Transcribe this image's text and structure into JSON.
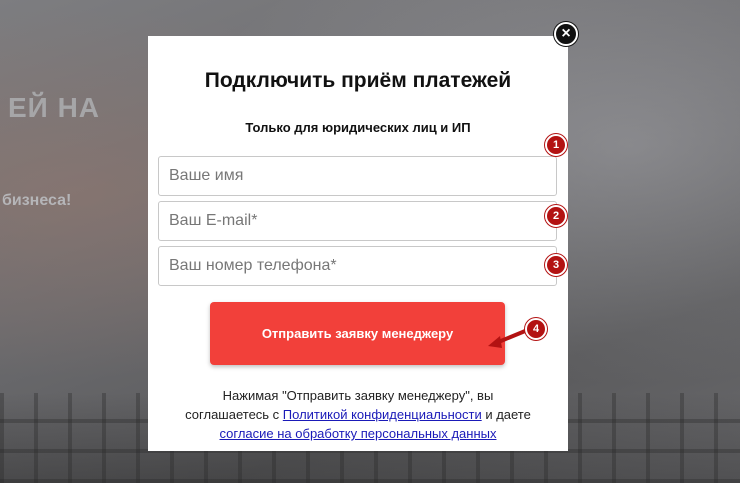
{
  "background": {
    "heading": "ЕЙ НА",
    "subtext": "бизнеса!"
  },
  "modal": {
    "close_symbol": "×",
    "title": "Подключить приём платежей",
    "subtitle": "Только для юридических лиц и ИП",
    "fields": {
      "name_placeholder": "Ваше имя",
      "email_placeholder": "Ваш E-mail*",
      "phone_placeholder": "Ваш номер телефона*"
    },
    "submit_label": "Отправить заявку менеджеру",
    "consent": {
      "line1": "Нажимая \"Отправить заявку менеджеру\", вы",
      "line2_prefix": "соглашаетесь с ",
      "privacy_link": "Политикой конфиденциальности",
      "line2_suffix": " и даете",
      "processing_link": "согласие на обработку персональных данных"
    }
  },
  "annotations": {
    "markers": [
      "1",
      "2",
      "3",
      "4"
    ],
    "color": "#b31212"
  },
  "colors": {
    "accent": "#f2403a"
  }
}
